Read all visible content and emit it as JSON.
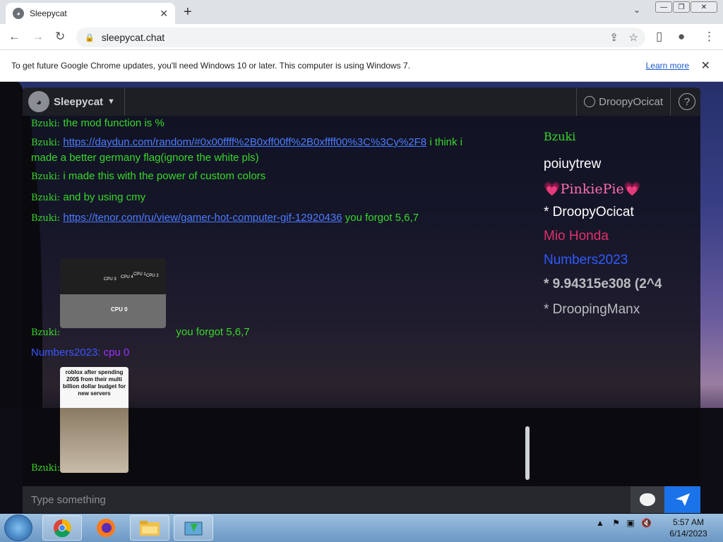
{
  "browser": {
    "tab_title": "Sleepycat",
    "url": "sleepycat.chat",
    "new_tab": "+",
    "close_tab": "✕",
    "minimize": "—",
    "restore": "❐",
    "close_window": "✕"
  },
  "infobar": {
    "text": "To get future Google Chrome updates, you'll need Windows 10 or later. This computer is using Windows 7.",
    "learn_more": "Learn more",
    "close": "✕"
  },
  "app": {
    "brand": "Sleepycat",
    "username": "DroopyOcicat",
    "help": "?",
    "input_placeholder": "Type something"
  },
  "messages": [
    {
      "name": "Bzuki:",
      "text": "the mod function is %"
    },
    {
      "name": "Bzuki:",
      "link": "https://daydun.com/random/#0x00ffff%2B0xff00ff%2B0xffff00%3C%3Cy%2F8",
      "text": " i think i made a better germany flag(ignore the white pls)"
    },
    {
      "name": "Bzuki:",
      "text": "i made this with the power of custom colors"
    },
    {
      "name": "Bzuki:",
      "text": "and by using cmy"
    },
    {
      "name": "Bzuki:",
      "link": "https://tenor.com/ru/view/gamer-hot-computer-gif-12920436",
      "text": " you forgot 5,6,7"
    },
    {
      "name": "Bzuki:",
      "text": "you forgot 5,6,7"
    },
    {
      "name": "Numbers2023:",
      "text": "cpu 0"
    },
    {
      "name": "Bzuki:",
      "text": ""
    }
  ],
  "gif1": {
    "labels": [
      "CPU 3",
      "CPU 4",
      "CPU 1",
      "CPU 2",
      "CPU 0"
    ]
  },
  "gif2": {
    "caption": "roblox after spending 200$ from their multi billion dollar budget for new servers"
  },
  "users": [
    {
      "name": "Bzuki",
      "color": "#39d82a"
    },
    {
      "name": "poiuytrew",
      "color": "#ffffff"
    },
    {
      "name": "💗PinkiePie💗",
      "color": "#ff6fb0"
    },
    {
      "name": " * DroopyOcicat",
      "color": "#ffffff"
    },
    {
      "name": "Mio Honda",
      "color": "#e0306a"
    },
    {
      "name": "Numbers2023",
      "color": "#2f5bff"
    },
    {
      "name": " * 9.94315e308 (2^4",
      "color": "#b9bcc0"
    },
    {
      "name": " * DroopingManx",
      "color": "#b9bcc0"
    }
  ],
  "clock": {
    "time": "5:57 AM",
    "date": "6/14/2023"
  }
}
